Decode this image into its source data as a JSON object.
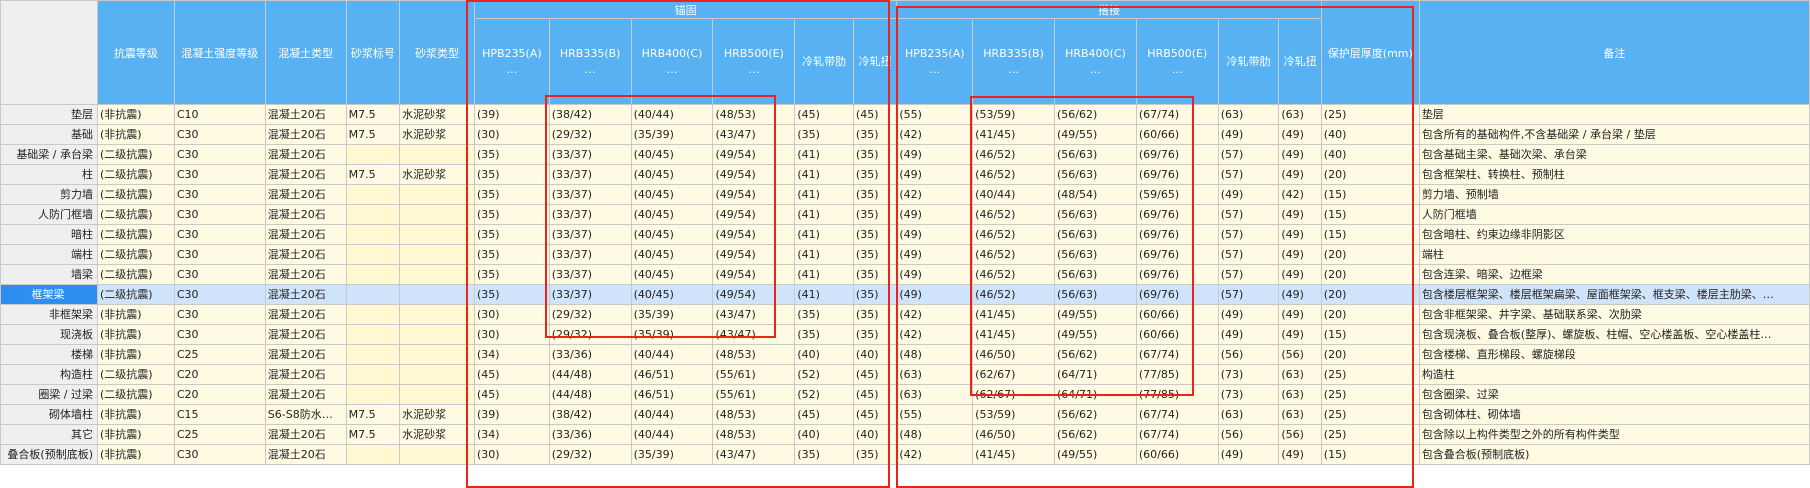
{
  "header": {
    "group_anchor": "锚固",
    "group_lap": "搭接",
    "columns": [
      "抗震等级",
      "混凝土强度等级",
      "混凝土类型",
      "砂浆标号",
      "砂浆类型",
      "HPB235(A)\n…",
      "HRB335(B)\n…",
      "HRB400(C)\n…",
      "HRB500(E)\n…",
      "冷轧带肋",
      "冷轧扭",
      "HPB235(A)\n…",
      "HRB335(B)\n…",
      "HRB400(C)\n…",
      "HRB500(E)\n…",
      "冷轧带肋",
      "冷轧扭",
      "保护层厚度(mm)",
      "备注"
    ]
  },
  "rows": [
    {
      "name": "垫层",
      "cells": [
        "(非抗震)",
        "C10",
        "混凝土20石",
        "M7.5",
        "水泥砂浆",
        "(39)",
        "(38/42)",
        "(40/44)",
        "(48/53)",
        "(45)",
        "(45)",
        "(55)",
        "(53/59)",
        "(56/62)",
        "(67/74)",
        "(63)",
        "(63)",
        "(25)",
        "垫层"
      ]
    },
    {
      "name": "基础",
      "cells": [
        "(非抗震)",
        "C30",
        "混凝土20石",
        "M7.5",
        "水泥砂浆",
        "(30)",
        "(29/32)",
        "(35/39)",
        "(43/47)",
        "(35)",
        "(35)",
        "(42)",
        "(41/45)",
        "(49/55)",
        "(60/66)",
        "(49)",
        "(49)",
        "(40)",
        "包含所有的基础构件,不含基础梁 / 承台梁 / 垫层"
      ]
    },
    {
      "name": "基础梁 / 承台梁",
      "cells": [
        "(二级抗震)",
        "C30",
        "混凝土20石",
        "",
        "",
        "(35)",
        "(33/37)",
        "(40/45)",
        "(49/54)",
        "(41)",
        "(35)",
        "(49)",
        "(46/52)",
        "(56/63)",
        "(69/76)",
        "(57)",
        "(49)",
        "(40)",
        "包含基础主梁、基础次梁、承台梁"
      ]
    },
    {
      "name": "柱",
      "cells": [
        "(二级抗震)",
        "C30",
        "混凝土20石",
        "M7.5",
        "水泥砂浆",
        "(35)",
        "(33/37)",
        "(40/45)",
        "(49/54)",
        "(41)",
        "(35)",
        "(49)",
        "(46/52)",
        "(56/63)",
        "(69/76)",
        "(57)",
        "(49)",
        "(20)",
        "包含框架柱、转换柱、预制柱"
      ]
    },
    {
      "name": "剪力墙",
      "cells": [
        "(二级抗震)",
        "C30",
        "混凝土20石",
        "",
        "",
        "(35)",
        "(33/37)",
        "(40/45)",
        "(49/54)",
        "(41)",
        "(35)",
        "(42)",
        "(40/44)",
        "(48/54)",
        "(59/65)",
        "(49)",
        "(42)",
        "(15)",
        "剪力墙、预制墙"
      ]
    },
    {
      "name": "人防门框墙",
      "cells": [
        "(二级抗震)",
        "C30",
        "混凝土20石",
        "",
        "",
        "(35)",
        "(33/37)",
        "(40/45)",
        "(49/54)",
        "(41)",
        "(35)",
        "(49)",
        "(46/52)",
        "(56/63)",
        "(69/76)",
        "(57)",
        "(49)",
        "(15)",
        "人防门框墙"
      ]
    },
    {
      "name": "暗柱",
      "cells": [
        "(二级抗震)",
        "C30",
        "混凝土20石",
        "",
        "",
        "(35)",
        "(33/37)",
        "(40/45)",
        "(49/54)",
        "(41)",
        "(35)",
        "(49)",
        "(46/52)",
        "(56/63)",
        "(69/76)",
        "(57)",
        "(49)",
        "(15)",
        "包含暗柱、约束边缘非阴影区"
      ]
    },
    {
      "name": "端柱",
      "cells": [
        "(二级抗震)",
        "C30",
        "混凝土20石",
        "",
        "",
        "(35)",
        "(33/37)",
        "(40/45)",
        "(49/54)",
        "(41)",
        "(35)",
        "(49)",
        "(46/52)",
        "(56/63)",
        "(69/76)",
        "(57)",
        "(49)",
        "(20)",
        "端柱"
      ]
    },
    {
      "name": "墙梁",
      "cells": [
        "(二级抗震)",
        "C30",
        "混凝土20石",
        "",
        "",
        "(35)",
        "(33/37)",
        "(40/45)",
        "(49/54)",
        "(41)",
        "(35)",
        "(49)",
        "(46/52)",
        "(56/63)",
        "(69/76)",
        "(57)",
        "(49)",
        "(20)",
        "包含连梁、暗梁、边框梁"
      ]
    },
    {
      "name": "框架梁",
      "cells": [
        "(二级抗震)",
        "C30",
        "混凝土20石",
        "",
        "",
        "(35)",
        "(33/37)",
        "(40/45)",
        "(49/54)",
        "(41)",
        "(35)",
        "(49)",
        "(46/52)",
        "(56/63)",
        "(69/76)",
        "(57)",
        "(49)",
        "(20)",
        "包含楼层框架梁、楼层框架扁梁、屋面框架梁、框支梁、楼层主肋梁、…"
      ]
    },
    {
      "name": "非框架梁",
      "cells": [
        "(非抗震)",
        "C30",
        "混凝土20石",
        "",
        "",
        "(30)",
        "(29/32)",
        "(35/39)",
        "(43/47)",
        "(35)",
        "(35)",
        "(42)",
        "(41/45)",
        "(49/55)",
        "(60/66)",
        "(49)",
        "(49)",
        "(20)",
        "包含非框架梁、井字梁、基础联系梁、次肋梁"
      ]
    },
    {
      "name": "现浇板",
      "cells": [
        "(非抗震)",
        "C30",
        "混凝土20石",
        "",
        "",
        "(30)",
        "(29/32)",
        "(35/39)",
        "(43/47)",
        "(35)",
        "(35)",
        "(42)",
        "(41/45)",
        "(49/55)",
        "(60/66)",
        "(49)",
        "(49)",
        "(15)",
        "包含现浇板、叠合板(整厚)、螺旋板、柱帽、空心楼盖板、空心楼盖柱…"
      ]
    },
    {
      "name": "楼梯",
      "cells": [
        "(非抗震)",
        "C25",
        "混凝土20石",
        "",
        "",
        "(34)",
        "(33/36)",
        "(40/44)",
        "(48/53)",
        "(40)",
        "(40)",
        "(48)",
        "(46/50)",
        "(56/62)",
        "(67/74)",
        "(56)",
        "(56)",
        "(20)",
        "包含楼梯、直形梯段、螺旋梯段"
      ]
    },
    {
      "name": "构造柱",
      "cells": [
        "(二级抗震)",
        "C20",
        "混凝土20石",
        "",
        "",
        "(45)",
        "(44/48)",
        "(46/51)",
        "(55/61)",
        "(52)",
        "(45)",
        "(63)",
        "(62/67)",
        "(64/71)",
        "(77/85)",
        "(73)",
        "(63)",
        "(25)",
        "构造柱"
      ]
    },
    {
      "name": "圈梁 / 过梁",
      "cells": [
        "(二级抗震)",
        "C20",
        "混凝土20石",
        "",
        "",
        "(45)",
        "(44/48)",
        "(46/51)",
        "(55/61)",
        "(52)",
        "(45)",
        "(63)",
        "(62/67)",
        "(64/71)",
        "(77/85)",
        "(73)",
        "(63)",
        "(25)",
        "包含圈梁、过梁"
      ]
    },
    {
      "name": "砌体墙柱",
      "cells": [
        "(非抗震)",
        "C15",
        "S6-S8防水…",
        "M7.5",
        "水泥砂浆",
        "(39)",
        "(38/42)",
        "(40/44)",
        "(48/53)",
        "(45)",
        "(45)",
        "(55)",
        "(53/59)",
        "(56/62)",
        "(67/74)",
        "(63)",
        "(63)",
        "(25)",
        "包含砌体柱、砌体墙"
      ]
    },
    {
      "name": "其它",
      "cells": [
        "(非抗震)",
        "C25",
        "混凝土20石",
        "M7.5",
        "水泥砂浆",
        "(34)",
        "(33/36)",
        "(40/44)",
        "(48/53)",
        "(40)",
        "(40)",
        "(48)",
        "(46/50)",
        "(56/62)",
        "(67/74)",
        "(56)",
        "(56)",
        "(25)",
        "包含除以上构件类型之外的所有构件类型"
      ]
    },
    {
      "name": "叠合板(预制底板)",
      "cells": [
        "(非抗震)",
        "C30",
        "混凝土20石",
        "",
        "",
        "(30)",
        "(29/32)",
        "(35/39)",
        "(43/47)",
        "(35)",
        "(35)",
        "(42)",
        "(41/45)",
        "(49/55)",
        "(60/66)",
        "(49)",
        "(49)",
        "(15)",
        "包含叠合板(预制底板)"
      ]
    }
  ],
  "selected_row_index": 9
}
